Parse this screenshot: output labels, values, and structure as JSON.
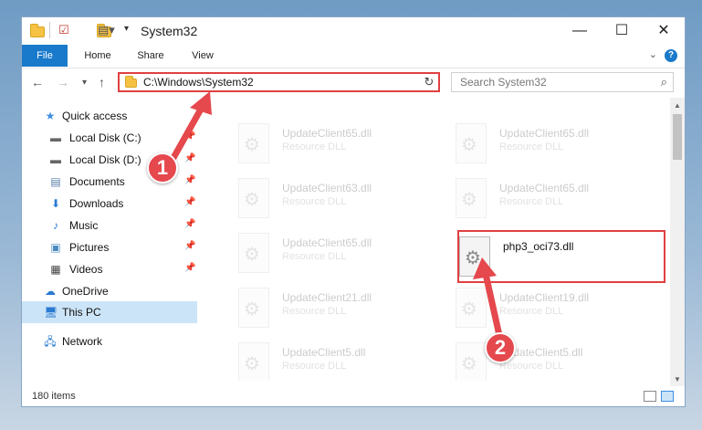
{
  "window": {
    "title": "System32",
    "controls": {
      "minimize": "—",
      "maximize": "☐",
      "close": "✕"
    }
  },
  "ribbon": {
    "tabs": [
      {
        "label": "File"
      },
      {
        "label": "Home"
      },
      {
        "label": "Share"
      },
      {
        "label": "View"
      }
    ]
  },
  "address": {
    "path": "C:\\Windows\\System32",
    "search_placeholder": "Search System32"
  },
  "sidebar": {
    "items": [
      {
        "label": "Quick access",
        "icon": "star-icon"
      },
      {
        "label": "Local Disk (C:)",
        "icon": "drive-icon",
        "pinned": true
      },
      {
        "label": "Local Disk (D:)",
        "icon": "drive-icon",
        "pinned": true
      },
      {
        "label": "Documents",
        "icon": "documents-icon",
        "pinned": true
      },
      {
        "label": "Downloads",
        "icon": "downloads-icon",
        "pinned": true
      },
      {
        "label": "Music",
        "icon": "music-icon",
        "pinned": true
      },
      {
        "label": "Pictures",
        "icon": "pictures-icon",
        "pinned": true
      },
      {
        "label": "Videos",
        "icon": "videos-icon",
        "pinned": true
      },
      {
        "label": "OneDrive",
        "icon": "cloud-icon"
      },
      {
        "label": "This PC",
        "icon": "computer-icon",
        "selected": true
      },
      {
        "label": "Network",
        "icon": "network-icon"
      }
    ]
  },
  "files": [
    {
      "name": "UpdateClient65.dll",
      "type": "Resource DLL"
    },
    {
      "name": "UpdateClient65.dll",
      "type": "Resource DLL"
    },
    {
      "name": "UpdateClient63.dll",
      "type": "Resource DLL"
    },
    {
      "name": "UpdateClient65.dll",
      "type": "Resource DLL"
    },
    {
      "name": "UpdateClient65.dll",
      "type": "Resource DLL"
    },
    {
      "name": "php3_oci73.dll",
      "type": ""
    },
    {
      "name": "UpdateClient21.dll",
      "type": "Resource DLL"
    },
    {
      "name": "UpdateClient19.dll",
      "type": "Resource DLL"
    },
    {
      "name": "UpdateClient5.dll",
      "type": "Resource DLL"
    },
    {
      "name": "UpdateClient5.dll",
      "type": "Resource DLL"
    }
  ],
  "status": {
    "item_count": "180 items"
  },
  "callouts": {
    "one": "1",
    "two": "2"
  },
  "colors": {
    "accent": "#1979ca",
    "highlight": "#e04040",
    "callout": "#e5484d"
  }
}
